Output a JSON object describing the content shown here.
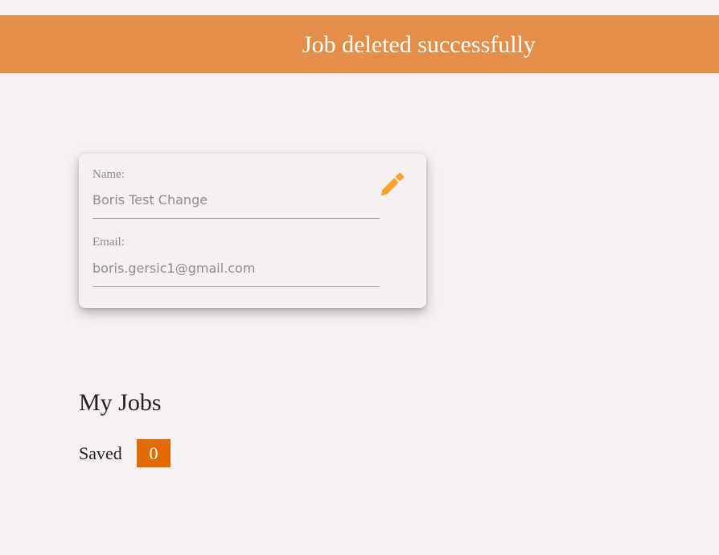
{
  "toast": {
    "message": "Job deleted successfully",
    "color": "#e38f4a"
  },
  "profile": {
    "name_label": "Name:",
    "name_value": "Boris Test Change",
    "email_label": "Email:",
    "email_value": "boris.gersic1@gmail.com",
    "edit_icon": "pencil-icon",
    "edit_icon_color": "#ffa12b"
  },
  "jobs": {
    "title": "My Jobs",
    "saved_label": "Saved",
    "saved_count": "0",
    "badge_color": "#e06a00"
  }
}
